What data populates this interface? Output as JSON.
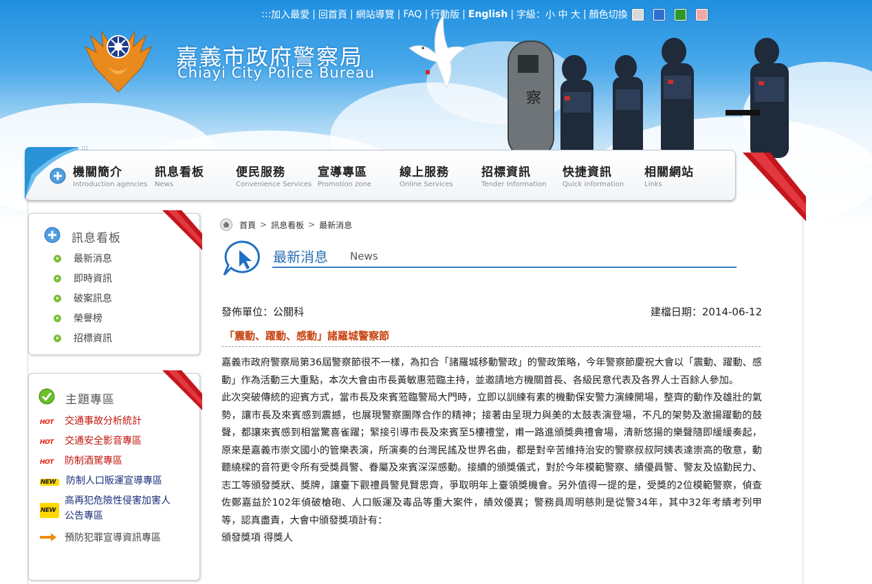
{
  "top_links": {
    "prefix": ":::",
    "items": [
      "加入最愛",
      "回首頁",
      "網站導覽",
      "FAQ",
      "行動版",
      "English"
    ],
    "font_label": "字級：",
    "font_sizes": [
      "小",
      "中",
      "大"
    ],
    "color_switch": "顏色切換",
    "swatch_colors": [
      "#d9d9d9",
      "#2f6fd1",
      "#2b9a2b",
      "#f2a8a8"
    ]
  },
  "header": {
    "title_zh": "嘉義市政府警察局",
    "title_en": "Chiayi City Police Bureau"
  },
  "nav": {
    "dots": ":::",
    "items": [
      {
        "zh": "機關簡介",
        "en": "Introduction agencies"
      },
      {
        "zh": "訊息看板",
        "en": "News"
      },
      {
        "zh": "便民服務",
        "en": "Convenience Services"
      },
      {
        "zh": "宣導專區",
        "en": "Promotion zone"
      },
      {
        "zh": "線上服務",
        "en": "Online Services"
      },
      {
        "zh": "招標資訊",
        "en": "Tender Information"
      },
      {
        "zh": "快捷資訊",
        "en": "Quick information"
      },
      {
        "zh": "相關網站",
        "en": "Links"
      }
    ]
  },
  "sidebar_news": {
    "title": "訊息看板",
    "items": [
      "最新消息",
      "即時資訊",
      "破案訊息",
      "榮譽榜",
      "招標資訊"
    ]
  },
  "sidebar_theme": {
    "title": "主題專區",
    "items": [
      {
        "badge": "HOT",
        "label": "交通事故分析統計",
        "color": "#c1140a"
      },
      {
        "badge": "HOT",
        "label": "交通安全影音專區",
        "color": "#c1140a"
      },
      {
        "badge": "HOT",
        "label": "防制酒駕專區",
        "color": "#c1140a"
      },
      {
        "badge": "NEW",
        "label": "防制人口販運宣導專區",
        "color": "#1a2f7a"
      },
      {
        "badge": "NEW",
        "label": "高再犯危險性侵害加害人",
        "label2": "公告專區",
        "color": "#1a2f7a"
      },
      {
        "badge": "",
        "label": "預防犯罪宣導資訊專區",
        "color": "#444"
      }
    ]
  },
  "breadcrumb": [
    "首頁",
    "訊息看板",
    "最新消息"
  ],
  "section": {
    "title": "最新消息",
    "title_en": "News"
  },
  "article": {
    "unit_label": "發佈單位：公關科",
    "date_label": "建檔日期：2014-06-12",
    "title": "「震動、躍動、感動」諸羅城警察節",
    "paragraphs": [
      "嘉義市政府警察局第36屆警察節很不一樣，為扣合「諸羅城移動警政」的警政策略，今年警察節慶祝大會以「震動、躍動、感動」作為活動三大重點，本次大會由市長黃敏惠蒞臨主持，並邀請地方機關首長、各級民意代表及各界人士百餘人參加。",
      "此次突破傳統的迎賓方式，當市長及來賓蒞臨警局大門時，立即以訓練有素的機動保安警力演練開場，整齊的動作及雄壯的氣勢，讓市長及來賓感到震撼，也展現警察團隊合作的精神；接著由呈現力與美的太鼓表演登場，不凡的架勢及激揚躍動的鼓聲，都讓來賓感到相當驚喜雀躍；緊接引導市長及來賓至5樓禮堂，甫一路進頒獎典禮會場，清新悠揚的樂聲隨即緩緩奏起，原來是嘉義市崇文國小的管樂表演，所演奏的台灣民謠及世界名曲，都是對辛苦維持治安的警察叔叔阿姨表達崇高的敬意，動聽繞樑的音符更令所有受獎員警、眷屬及來賓深深感動。接續的頒獎儀式，對於今年模範警察、績優員警、警友及協勤民力、志工等頒發獎狀、獎牌，讓臺下觀禮員警見賢思齊，爭取明年上臺領獎機會。另外值得一提的是，受獎的2位模範警察，偵查佐鄭嘉益於102年偵破槍砲、人口販運及毒品等重大案件，績效優異；警務員周明慈則是從警34年，其中32年考績考列甲等，認真盡責，大會中頒發獎項計有：",
      "頒發獎項 得獎人"
    ]
  }
}
